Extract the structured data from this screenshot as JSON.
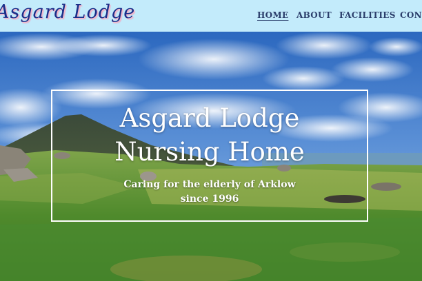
{
  "logo": {
    "text": "Asgard Lodge"
  },
  "nav": {
    "items": [
      {
        "label": "HOME",
        "active": true
      },
      {
        "label": "ABOUT",
        "active": false
      },
      {
        "label": "FACILITIES",
        "active": false
      },
      {
        "label": "CONTACT",
        "active": false
      }
    ]
  },
  "hero": {
    "title_line1": "Asgard Lodge",
    "title_line2": "Nursing Home",
    "subtitle_line1": "Caring for the elderly of Arklow",
    "subtitle_line2": "since 1996",
    "image": "mountain-landscape-photo"
  },
  "colors": {
    "header_bg": "#c3ebfb",
    "logo": "#1a2f8a",
    "nav_text": "#2b3e6b",
    "overlay_text": "#ffffff"
  }
}
